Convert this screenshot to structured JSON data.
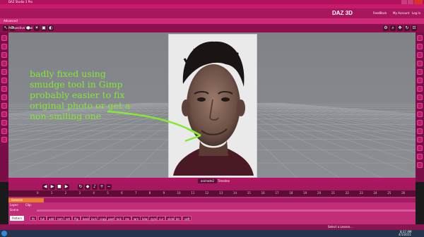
{
  "window": {
    "title": "DAZ Studio 3 Pro"
  },
  "menu": [
    "File",
    "Edit",
    "Create",
    "Tools",
    "Render",
    "Connect",
    "Window",
    "Help"
  ],
  "daz_bar": {
    "logo": "DAZ 3D",
    "links": [
      "FeedBack",
      "My Account",
      "Log In"
    ]
  },
  "mode_tab": "Advanced",
  "viewport": {
    "title": "Perspective View"
  },
  "annotation": {
    "text": "badly fixed using\nsmudge tool in Gimp\nprobably easier to fix\noriginal photo or get a\nnon-smiling one",
    "color": "#87e832"
  },
  "timeline": {
    "tabs": [
      "animate2",
      "Timeline"
    ],
    "ruler_ticks": [
      "0",
      "1",
      "2",
      "3",
      "4",
      "5",
      "6",
      "7",
      "8",
      "9",
      "10",
      "11",
      "12",
      "13",
      "14",
      "15",
      "16",
      "17",
      "18",
      "19",
      "20",
      "21",
      "22",
      "23",
      "24",
      "25",
      "26"
    ],
    "layer_label": "General",
    "row_labels": [
      "Layer:",
      "Clip:"
    ],
    "scene_label": "Scene",
    "key_buttons": [
      "fit",
      "full",
      "add",
      "rem",
      "set",
      "flip",
      "beat",
      "lock",
      "copy",
      "past",
      "bck",
      "res",
      "wm",
      "lolw",
      "sync",
      "cur",
      "slide",
      "blr",
      "saft"
    ],
    "playback_field": "Pattern"
  },
  "status": {
    "lesson_select": "Select a Lesson..."
  },
  "taskbar": {
    "time": "8:37 AM",
    "date": "4/1/2011"
  },
  "colors": {
    "accent": "#c22d79",
    "dark_accent": "#7a0e46",
    "viewport_bg": "#878a8e"
  }
}
